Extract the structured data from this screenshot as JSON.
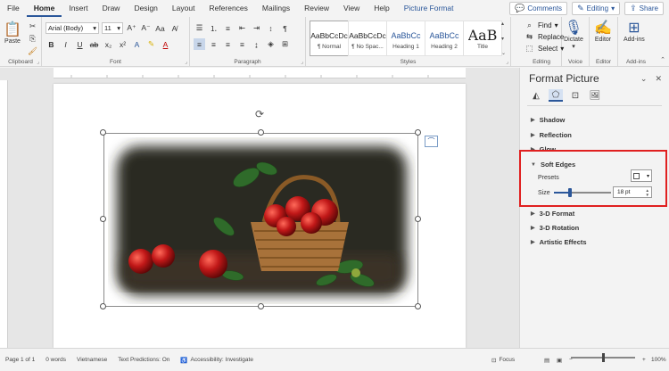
{
  "tabs": [
    {
      "label": "File"
    },
    {
      "label": "Home",
      "active": true
    },
    {
      "label": "Insert"
    },
    {
      "label": "Draw"
    },
    {
      "label": "Design"
    },
    {
      "label": "Layout"
    },
    {
      "label": "References"
    },
    {
      "label": "Mailings"
    },
    {
      "label": "Review"
    },
    {
      "label": "View"
    },
    {
      "label": "Help"
    },
    {
      "label": "Picture Format",
      "contextual": true
    }
  ],
  "tab_right": {
    "comments": "Comments",
    "editing": "Editing",
    "share": "Share"
  },
  "ribbon": {
    "clipboard": {
      "paste": "Paste",
      "label": "Clipboard"
    },
    "font": {
      "family": "Arial (Body)",
      "size": "11",
      "label": "Font"
    },
    "paragraph": {
      "label": "Paragraph"
    },
    "styles": {
      "label": "Styles",
      "items": [
        {
          "preview": "AaBbCcDc",
          "name": "¶ Normal",
          "selected": true
        },
        {
          "preview": "AaBbCcDc",
          "name": "¶ No Spac..."
        },
        {
          "preview": "AaBbCc",
          "name": "Heading 1"
        },
        {
          "preview": "AaBbCc",
          "name": "Heading 2"
        },
        {
          "preview": "AaB",
          "name": "Title"
        }
      ]
    },
    "editing": {
      "find": "Find",
      "replace": "Replace",
      "select": "Select",
      "label": "Editing"
    },
    "voice": {
      "dictate": "Dictate",
      "label": "Voice"
    },
    "editor": {
      "button": "Editor",
      "label": "Editor"
    },
    "addins": {
      "button": "Add-ins",
      "label": "Add-ins"
    }
  },
  "pane": {
    "title": "Format Picture",
    "sections": {
      "shadow": "Shadow",
      "reflection": "Reflection",
      "glow": "Glow",
      "soft_edges": "Soft Edges",
      "format3d": "3-D Format",
      "rotation3d": "3-D Rotation",
      "artistic": "Artistic Effects"
    },
    "soft_edges": {
      "presets_label": "Presets",
      "size_label": "Size",
      "size_value": "18 pt",
      "slider_fraction": 0.28
    }
  },
  "status": {
    "page": "Page 1 of 1",
    "words": "0 words",
    "language": "Vietnamese",
    "text_predictions": "Text Predictions: On",
    "accessibility": "Accessibility: Investigate",
    "focus": "Focus",
    "zoom": "100%",
    "zoom_fraction": 0.5
  },
  "colors": {
    "accent": "#2b579a",
    "highlight_box": "#e02020"
  }
}
